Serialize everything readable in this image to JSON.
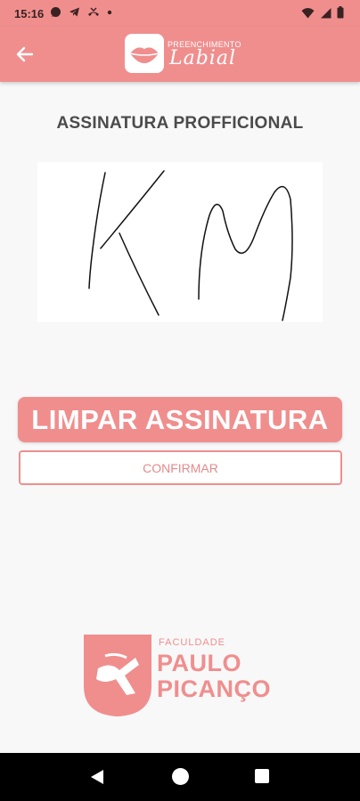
{
  "status_bar": {
    "time": "15:16",
    "left_icons": [
      "whatsapp-icon",
      "telegram-icon",
      "missed-call-icon",
      "dot-icon"
    ],
    "right_icons": [
      "wifi-icon",
      "signal-icon",
      "battery-icon"
    ]
  },
  "app_bar": {
    "back_icon": "arrow-left-icon",
    "logo_top": "PREENCHIMENTO",
    "logo_bottom": "Labial"
  },
  "main": {
    "title": "ASSINATURA PROFFICIONAL",
    "clear_button": "LIMPAR ASSINATURA",
    "confirm_button": "CONFIRMAR"
  },
  "footer_logo": {
    "small": "FACULDADE",
    "line1": "PAULO",
    "line2": "PICANÇO"
  },
  "colors": {
    "accent": "#f08e8e",
    "background": "#f8f8f8",
    "title_text": "#4b4b4b"
  },
  "nav_bar": {
    "icons": [
      "back-triangle-icon",
      "home-circle-icon",
      "recents-square-icon"
    ]
  }
}
